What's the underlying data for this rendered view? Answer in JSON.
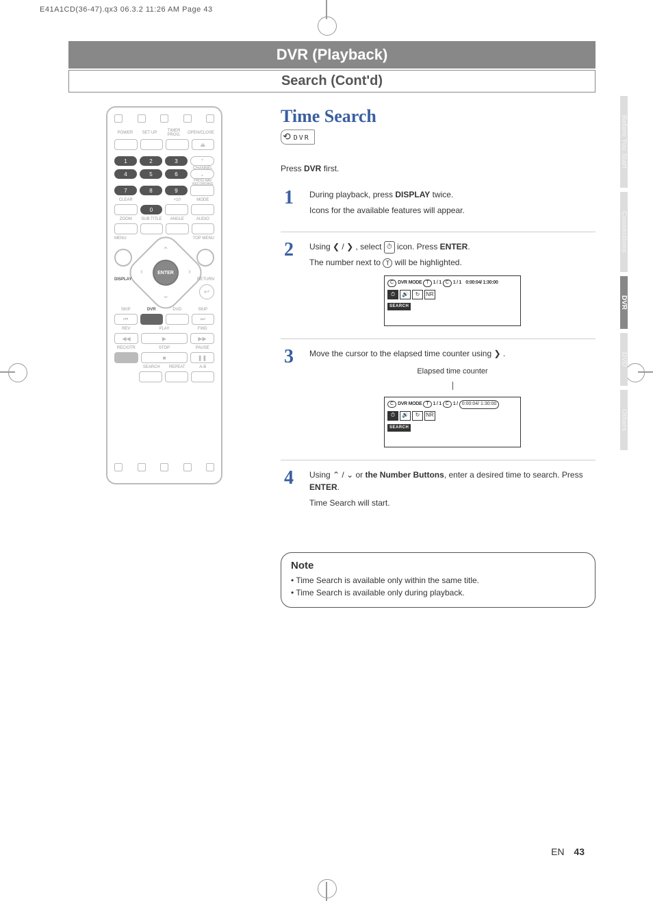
{
  "crop_header": "E41A1CD(36-47).qx3  06.3.2 11:26 AM  Page 43",
  "title_bar": "DVR (Playback)",
  "subtitle_bar": "Search (Cont'd)",
  "tabs": [
    "Before You Start",
    "Connections",
    "DVR",
    "DVD",
    "Others"
  ],
  "active_tab_index": 2,
  "section_title": "Time Search",
  "logo_text": "DVR",
  "intro_before": "Press ",
  "intro_bold": "DVR",
  "intro_after": " first.",
  "steps": [
    {
      "num": "1",
      "line1a": "During playback, press ",
      "line1b": "DISPLAY",
      "line1c": " twice.",
      "line2": "Icons for the available features will appear."
    },
    {
      "num": "2",
      "line1a": "Using ❮ / ❯ , select ",
      "line1icon": "⏱",
      "line1b": " icon.  Press ",
      "line1c": "ENTER",
      "line1d": ".",
      "line2a": "The number next to  ",
      "line2icon": "T",
      "line2b": "  will be highlighted."
    },
    {
      "num": "3",
      "line1": "Move the cursor to the elapsed time counter using ❯ .",
      "caption": "Elapsed time counter"
    },
    {
      "num": "4",
      "line1a": "Using ⌃ / ⌄ or ",
      "line1b": "the Number Buttons",
      "line1c": ", enter a desired time to search.  Press ",
      "line1d": "ENTER",
      "line1e": ".",
      "line2": "Time Search will start."
    }
  ],
  "osd1": {
    "c_badge": "C",
    "mode": "DVR MODE",
    "t_badge": "T",
    "title_frac": "1 / 1",
    "c2_badge": "C",
    "chap_frac": "1 / 1",
    "time": "0:00:04/ 1:30:00",
    "icons": [
      "⏱",
      "🔊",
      "↻",
      "NR"
    ],
    "active_icon": 0,
    "search_label": "SEARCH"
  },
  "osd2": {
    "c_badge": "C",
    "mode": "DVR MODE",
    "t_badge": "T",
    "title_frac": "1 / 1",
    "c2_badge": "C",
    "chap_frac": "1 /",
    "time_highlight": "0:00:04/ 1:30:00",
    "icons": [
      "⏱",
      "🔊",
      "↻",
      "NR"
    ],
    "active_icon": 0,
    "search_label": "SEARCH"
  },
  "note": {
    "title": "Note",
    "items": [
      "Time Search is available only within the same title.",
      "Time Search is available only during playback."
    ]
  },
  "footer": {
    "lang": "EN",
    "page": "43"
  },
  "remote": {
    "top_labels": [
      "POWER",
      "SET UP",
      "TIMER PROG.",
      "OPEN/CLOSE"
    ],
    "eject": "⏏",
    "numpad": [
      [
        "1",
        "2",
        "3"
      ],
      [
        "4",
        "5",
        "6"
      ],
      [
        "7",
        "8",
        "9"
      ]
    ],
    "channel_label": "CHANNEL",
    "progrec_label": "PROG.NAV RECORDING",
    "row_clear": {
      "labels": [
        "CLEAR",
        "",
        "+10",
        "MODE"
      ],
      "zero": "0"
    },
    "row_zasa": [
      "ZOOM",
      "SUB TITLE",
      "ANGLE",
      "AUDIO"
    ],
    "menu_left": "MENU",
    "menu_right": "TOP MENU",
    "enter": "ENTER",
    "display": "DISPLAY",
    "return": "RETURN",
    "return_sym": "↩",
    "row_skip_labels": [
      "SKIP",
      "DVR",
      "DVD",
      "SKIP"
    ],
    "skip_prev": "⏮",
    "skip_next": "⏭",
    "row_play_labels": [
      "REV",
      "PLAY",
      "FWD"
    ],
    "rev": "◀◀",
    "play": "▶",
    "fwd": "▶▶",
    "row_rec_labels": [
      "REC/OTR",
      "STOP",
      "PAUSE"
    ],
    "stop": "■",
    "pause": "❚❚",
    "row_search_labels": [
      "SEARCH",
      "REPEAT",
      "A-B"
    ]
  }
}
